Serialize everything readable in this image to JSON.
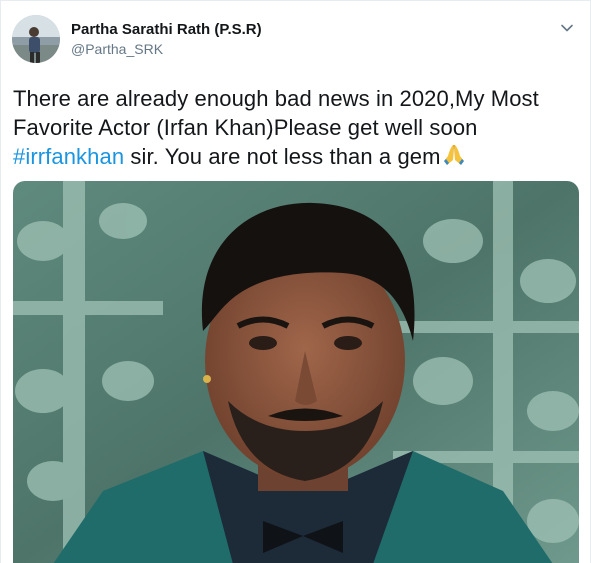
{
  "user": {
    "display_name": "Partha Sarathi Rath (P.S.R)",
    "handle": "@Partha_SRK",
    "avatar_icon": "user-avatar"
  },
  "tweet": {
    "text_line_1": "There are already enough bad news in 2020,My Most",
    "text_line_2": "Favorite Actor (Irfan Khan)Please get well soon",
    "hashtag": "#irrfankhan",
    "text_line_3_rest": " sir. You are not less than a gem",
    "emoji_icon": "folded-hands-emoji"
  },
  "menu": {
    "icon": "chevron-down-icon"
  },
  "colors": {
    "name": "#14171a",
    "handle": "#657786",
    "hashtag": "#1b95e0",
    "caret": "#657786",
    "image_bg": "#7aa89a"
  }
}
